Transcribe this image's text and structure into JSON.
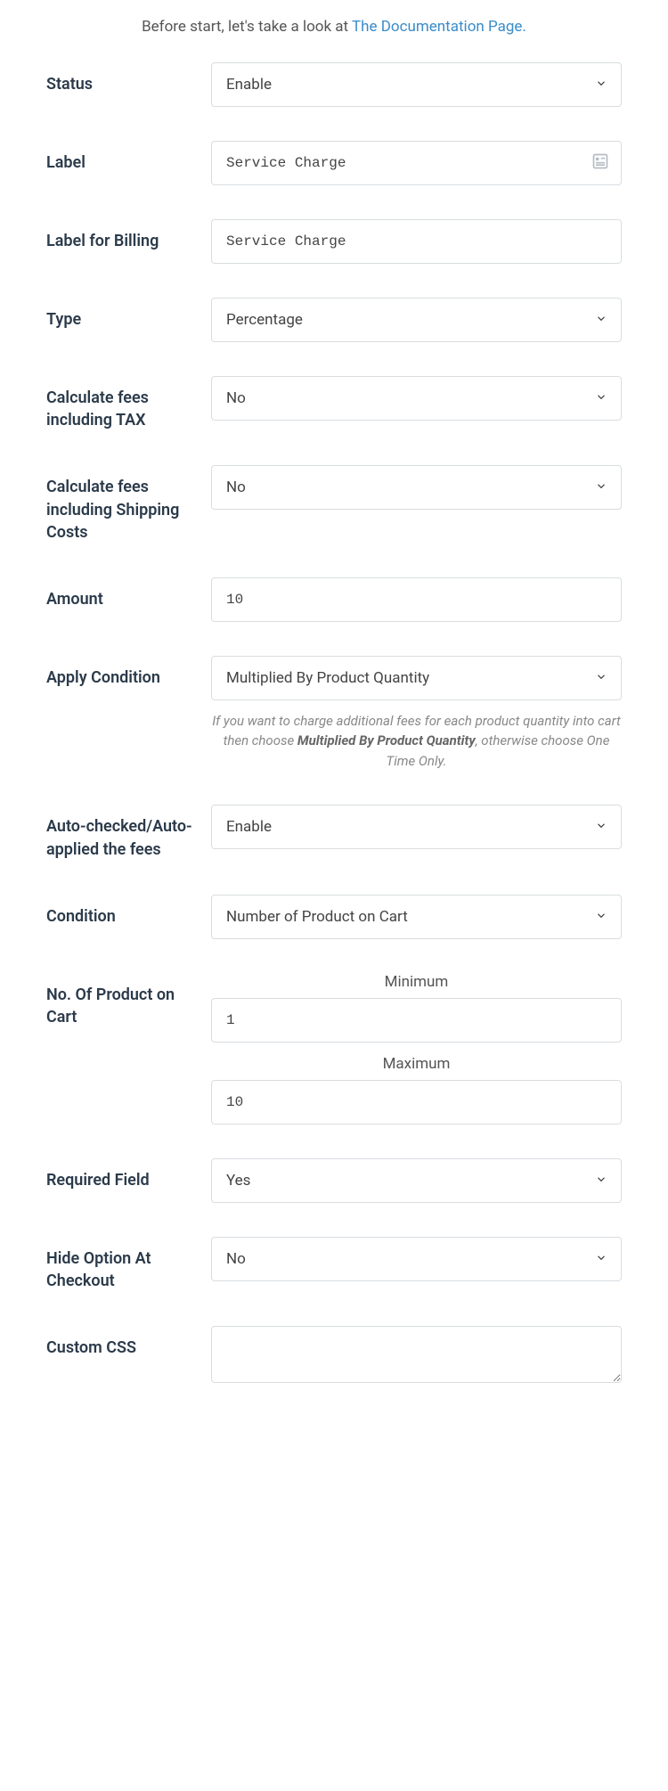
{
  "intro": {
    "prefix": "Before start, let's take a look at ",
    "link": "The Documentation Page."
  },
  "fields": {
    "status": {
      "label": "Status",
      "value": "Enable"
    },
    "label": {
      "label": "Label",
      "value": "Service Charge"
    },
    "labelBilling": {
      "label": "Label for Billing",
      "value": "Service Charge"
    },
    "type": {
      "label": "Type",
      "value": "Percentage"
    },
    "includeTax": {
      "label": "Calculate fees including TAX",
      "value": "No"
    },
    "includeShipping": {
      "label": "Calculate fees including Shipping Costs",
      "value": "No"
    },
    "amount": {
      "label": "Amount",
      "value": "10"
    },
    "applyCondition": {
      "label": "Apply Condition",
      "value": "Multiplied By Product Quantity",
      "help_prefix": "If you want to charge additional fees for each product quantity into cart then choose ",
      "help_bold": "Multiplied By Product Quantity",
      "help_suffix": ", otherwise choose One Time Only."
    },
    "autoApplied": {
      "label": "Auto-checked/Auto-applied the fees",
      "value": "Enable"
    },
    "condition": {
      "label": "Condition",
      "value": "Number of Product on Cart"
    },
    "noProduct": {
      "label": "No. Of Product on Cart",
      "minLabel": "Minimum",
      "minValue": "1",
      "maxLabel": "Maximum",
      "maxValue": "10"
    },
    "requiredField": {
      "label": "Required Field",
      "value": "Yes"
    },
    "hideOption": {
      "label": "Hide Option At Checkout",
      "value": "No"
    },
    "customCss": {
      "label": "Custom CSS",
      "value": ""
    }
  }
}
